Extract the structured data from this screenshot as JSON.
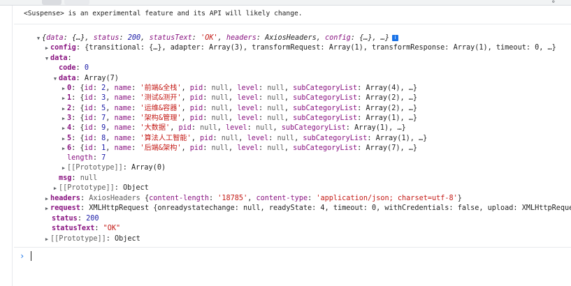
{
  "warning": "<Suspense> is an experimental feature and its API will likely change.",
  "response": {
    "summary": {
      "open": "{",
      "data_key": "data",
      "data_val": "{…}",
      "status_key": "status",
      "status_val": "200",
      "statusText_key": "statusText",
      "statusText_val": "'OK'",
      "headers_key": "headers",
      "headers_val": "AxiosHeaders",
      "config_key": "config",
      "config_val": "{…}",
      "ellipsis": "…}"
    },
    "config": {
      "key": "config",
      "preview": "{transitional: {…}, adapter: Array(3), transformRequest: Array(1), transformResponse: Array(1), timeout: 0, …}"
    },
    "data": {
      "key": "data",
      "code_key": "code",
      "code_val": "0",
      "inner_key": "data",
      "inner_val": "Array(7)",
      "items": [
        {
          "index": "0",
          "id": "2",
          "name": "'前端&全栈'",
          "cats": "Array(4)"
        },
        {
          "index": "1",
          "id": "3",
          "name": "'测试&测开'",
          "cats": "Array(2)"
        },
        {
          "index": "2",
          "id": "5",
          "name": "'运维&容器'",
          "cats": "Array(2)"
        },
        {
          "index": "3",
          "id": "7",
          "name": "'架构&管理'",
          "cats": "Array(1)"
        },
        {
          "index": "4",
          "id": "9",
          "name": "'大数据'",
          "cats": "Array(1)"
        },
        {
          "index": "5",
          "id": "8",
          "name": "'算法人工智能'",
          "cats": "Array(1)"
        },
        {
          "index": "6",
          "id": "1",
          "name": "'后端&架构'",
          "cats": "Array(7)"
        }
      ],
      "length_key": "length",
      "length_val": "7",
      "proto_inner": "[[Prototype]]",
      "proto_inner_val": "Array(0)",
      "msg_key": "msg",
      "msg_val": "null",
      "proto_data": "[[Prototype]]",
      "proto_data_val": "Object"
    },
    "headers": {
      "key": "headers",
      "type": "AxiosHeaders",
      "preview_open": "{",
      "cl_key": "content-length",
      "cl_val": "'18785'",
      "ct_key": "content-type",
      "ct_val": "'application/json; charset=utf-8'",
      "close": "}"
    },
    "request": {
      "key": "request",
      "preview": "XMLHttpRequest {onreadystatechange: null, readyState: 4, timeout: 0, withCredentials: false, upload: XMLHttpRequest"
    },
    "status": {
      "key": "status",
      "val": "200"
    },
    "statusText": {
      "key": "statusText",
      "val": "\"OK\""
    },
    "proto": {
      "key": "[[Prototype]]",
      "val": "Object"
    }
  },
  "labels": {
    "id": "id",
    "name": "name",
    "pid": "pid",
    "level": "level",
    "null": "null",
    "subCategoryList": "subCategoryList",
    "more": "…}"
  },
  "prompt": "›"
}
